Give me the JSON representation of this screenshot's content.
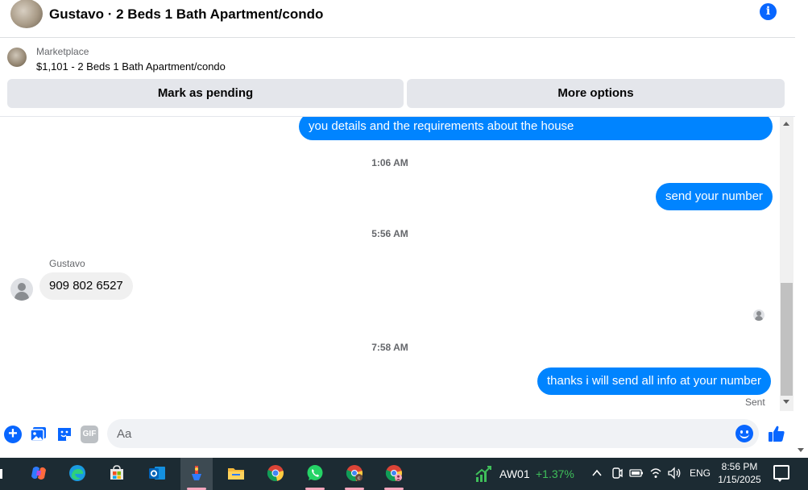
{
  "header": {
    "title": "Gustavo · 2 Beds 1 Bath Apartment/condo",
    "info_icon": "info-icon"
  },
  "marketplace": {
    "label": "Marketplace",
    "listing": "$1,101 - 2 Beds 1 Bath Apartment/condo",
    "mark_pending_label": "Mark as pending",
    "more_options_label": "More options"
  },
  "messages": {
    "m1_text": "you details and the requirements about the house",
    "t1": "1:06 AM",
    "m2_text": "send your number",
    "t2": "5:56 AM",
    "sender_name": "Gustavo",
    "m3_text": "909 802 6527",
    "t3": "7:58 AM",
    "m4_text": "thanks i will send all info at your number",
    "sent_status": "Sent"
  },
  "composer": {
    "placeholder": "Aa",
    "gif_label": "GIF"
  },
  "taskbar": {
    "stock_name": "AW01",
    "stock_change": "+1.37%",
    "lang": "ENG",
    "time": "8:56 PM",
    "date": "1/15/2025"
  },
  "colors": {
    "messenger_blue": "#0084ff",
    "accent_blue": "#0866ff",
    "taskbar_bg": "#1c2b33",
    "stock_green": "#3fbf5a"
  }
}
